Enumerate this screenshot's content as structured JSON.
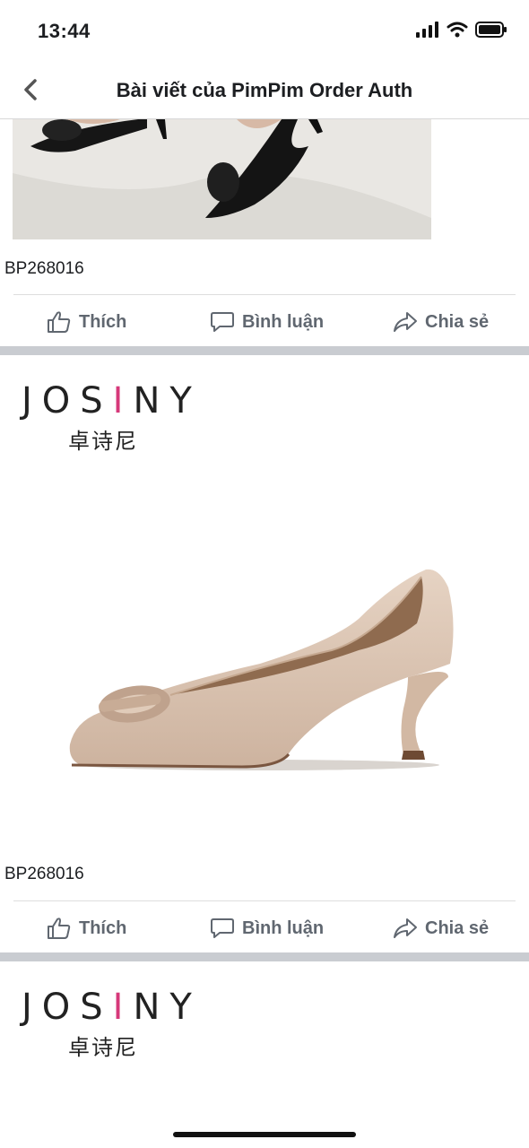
{
  "status": {
    "time": "13:44"
  },
  "nav": {
    "title": "Bài viết của PimPim Order Auth"
  },
  "posts": [
    {
      "caption": "BP268016",
      "actions": {
        "like": "Thích",
        "comment": "Bình luận",
        "share": "Chia sẻ"
      }
    },
    {
      "brand": {
        "name_left": "JOS",
        "name_i": "I",
        "name_right": "NY",
        "chinese": "卓诗尼"
      },
      "caption": "BP268016",
      "actions": {
        "like": "Thích",
        "comment": "Bình luận",
        "share": "Chia sẻ"
      }
    },
    {
      "brand": {
        "name_left": "JOS",
        "name_i": "I",
        "name_right": "NY",
        "chinese": "卓诗尼"
      }
    }
  ],
  "colors": {
    "brand_accent": "#d6397a",
    "action_text": "#606770",
    "separator": "#c9ccd1"
  },
  "icons": [
    "back-chevron-icon",
    "signal-icon",
    "wifi-icon",
    "battery-icon",
    "thumbs-up-icon",
    "comment-icon",
    "share-icon"
  ]
}
